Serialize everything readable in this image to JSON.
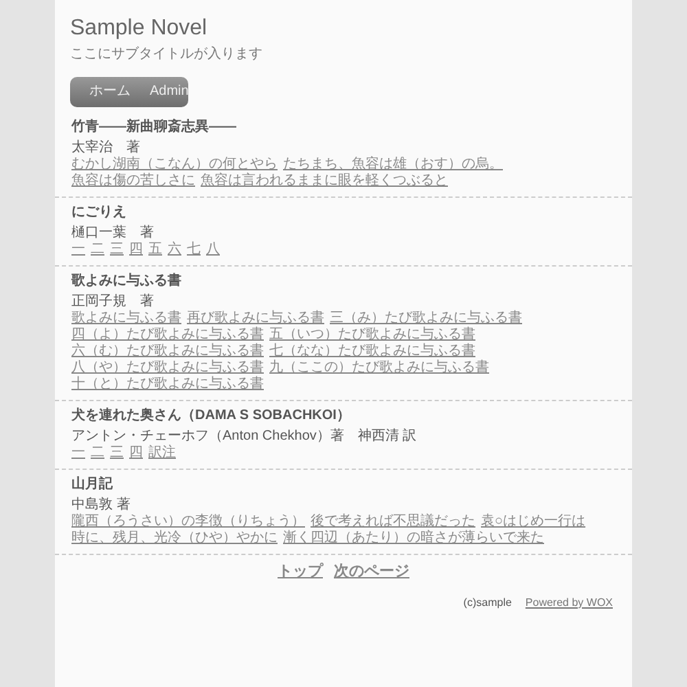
{
  "site": {
    "title": "Sample Novel",
    "subtitle": "ここにサブタイトルが入ります"
  },
  "nav": [
    {
      "label": "ホーム"
    },
    {
      "label": "Admin"
    }
  ],
  "works": [
    {
      "title": "竹青——新曲聊斎志異——",
      "author": "太宰治　著",
      "links": [
        "むかし湖南（こなん）の何とやら",
        "たちまち、魚容は雄（おす）の烏。",
        "魚容は傷の苦しさに",
        "魚容は言われるままに眼を軽くつぶると"
      ]
    },
    {
      "title": "にごりえ",
      "author": "樋口一葉　著",
      "links": [
        "一",
        "二",
        "三",
        "四",
        "五",
        "六",
        "七",
        "八"
      ]
    },
    {
      "title": "歌よみに与ふる書",
      "author": "正岡子規　著",
      "links": [
        "歌よみに与ふる書",
        "再び歌よみに与ふる書",
        "三（み）たび歌よみに与ふる書",
        "四（よ）たび歌よみに与ふる書",
        "五（いつ）たび歌よみに与ふる書",
        "六（む）たび歌よみに与ふる書",
        "七（なな）たび歌よみに与ふる書",
        "八（や）たび歌よみに与ふる書",
        "九（ここの）たび歌よみに与ふる書",
        "十（と）たび歌よみに与ふる書"
      ]
    },
    {
      "title": "犬を連れた奥さん（DAMA S SOBACHKOI）",
      "author": "アントン・チェーホフ（Anton Chekhov）著　神西清 訳",
      "links": [
        "一",
        "二",
        "三",
        "四",
        "訳注"
      ]
    },
    {
      "title": "山月記",
      "author": "中島敦 著",
      "links": [
        "隴西（ろうさい）の李徴（りちょう）",
        "後で考えれば不思議だった",
        "袁○はじめ一行は",
        "時に、残月、光冷（ひや）やかに",
        "漸く四辺（あたり）の暗さが薄らいで来た"
      ]
    }
  ],
  "pager": [
    "トップ",
    "次のページ"
  ],
  "footer": {
    "copyright": "(c)sample",
    "powered": "Powered by WOX"
  }
}
